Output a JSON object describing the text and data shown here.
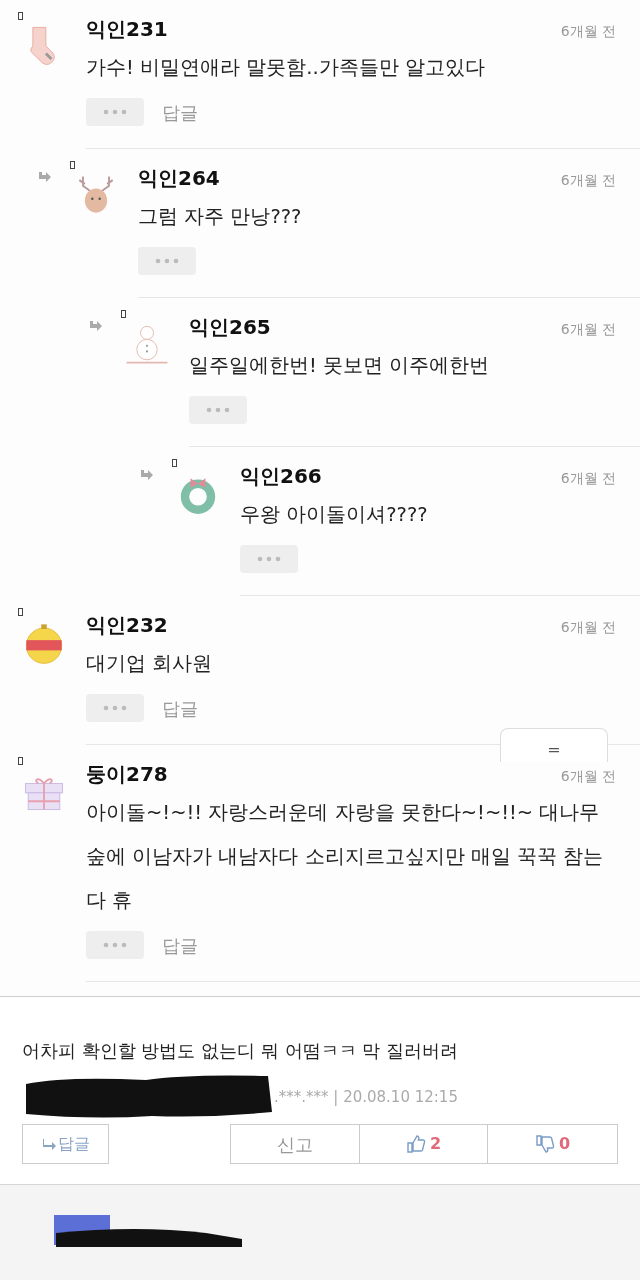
{
  "comments": [
    {
      "kind": "sock",
      "nickname": "익인231",
      "time": "6개월 전",
      "text": "가수! 비밀연애라 말못함..가족들만 알고있다",
      "reply_label": "답글",
      "children": [
        {
          "kind": "deer",
          "nickname": "익인264",
          "time": "6개월 전",
          "text": "그럼 자주 만낭???",
          "children": [
            {
              "kind": "snowman",
              "nickname": "익인265",
              "time": "6개월 전",
              "text": "일주일에한번! 못보면 이주에한번",
              "children": [
                {
                  "kind": "wreath",
                  "nickname": "익인266",
                  "time": "6개월 전",
                  "text": "우왕 아이돌이셔????"
                }
              ]
            }
          ]
        }
      ]
    },
    {
      "kind": "ornament",
      "nickname": "익인232",
      "time": "6개월 전",
      "text": "대기업 회사원",
      "reply_label": "답글"
    },
    {
      "kind": "gift",
      "nickname": "둥이278",
      "time": "6개월 전",
      "text": "아이돌~!~!! 자랑스러운데 자랑을 못한다~!~!!~ 대나무숲에 이남자가 내남자다 소리지르고싶지만 매일 꾹꾹 참는다 휴",
      "reply_label": "답글"
    }
  ],
  "floating_button": {
    "label": "="
  },
  "post_comment": {
    "text": "어차피 확인할 방법도 없는디 뭐 어떰ㅋㅋ 막 질러버려",
    "meta": ".***.*** | 20.08.10 12:15",
    "reply_button": "답글",
    "report_button": "신고",
    "likes": "2",
    "dislikes": "0"
  }
}
